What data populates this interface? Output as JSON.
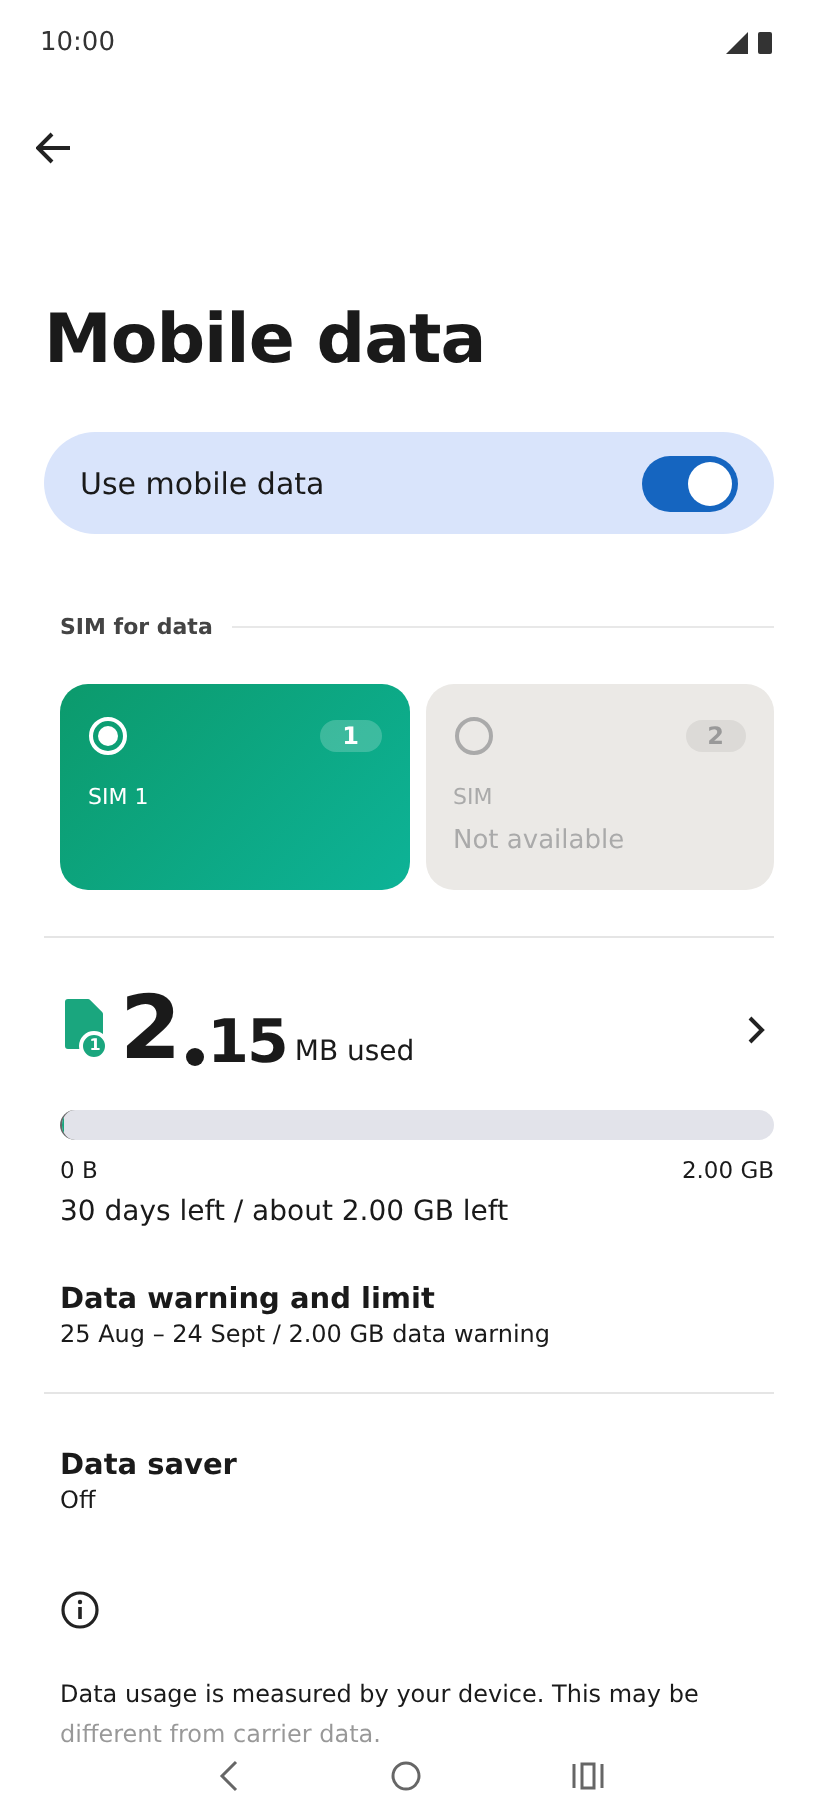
{
  "status_bar": {
    "time": "10:00"
  },
  "title": "Mobile data",
  "mobile_data": {
    "label": "Use mobile data",
    "on": true
  },
  "sim_section": {
    "label": "SIM for data"
  },
  "sims": [
    {
      "badge": "1",
      "name": "SIM 1",
      "selected": true,
      "disabled": false
    },
    {
      "badge": "2",
      "name": "SIM",
      "status": "Not available",
      "selected": false,
      "disabled": true
    }
  ],
  "usage": {
    "sim_badge": "1",
    "amount_int": "2",
    "amount_dec": "15",
    "unit": "MB used",
    "level": 0.001,
    "min": "0 B",
    "max": "2.00 GB",
    "remaining": "30 days left / about 2.00 GB left"
  },
  "settings": [
    {
      "title": "Data warning and limit",
      "subtitle": "25 Aug – 24 Sept / 2.00 GB data warning",
      "divider": true
    },
    {
      "title": "Data saver",
      "subtitle": "Off",
      "divider": false
    }
  ],
  "info": "Data usage is measured by your device. This may be different from carrier data."
}
